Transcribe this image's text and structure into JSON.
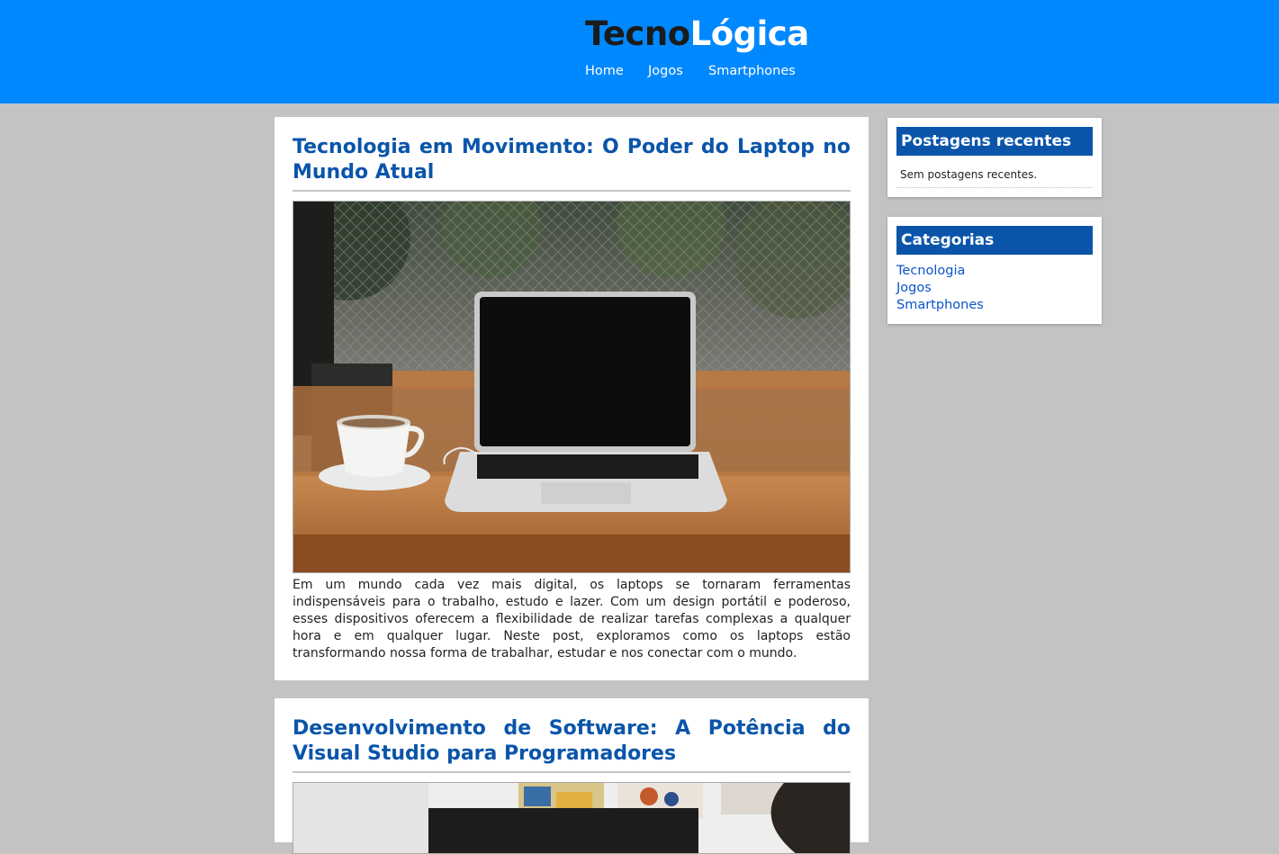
{
  "site": {
    "logo_part1": "Tecno",
    "logo_part2": "Lógica",
    "nav": [
      "Home",
      "Jogos",
      "Smartphones"
    ]
  },
  "posts": [
    {
      "title": "Tecnologia em Movimento: O Poder do Laptop no Mundo Atual",
      "image_icon": "laptop-photo-icon",
      "excerpt": "Em um mundo cada vez mais digital, os laptops se tornaram ferramentas indispensáveis para o trabalho, estudo e lazer. Com um design portátil e poderoso, esses dispositivos oferecem a flexibilidade de realizar tarefas complexas a qualquer hora e em qualquer lugar. Neste post, exploramos como os laptops estão transformando nossa forma de trabalhar, estudar e nos conectar com o mundo."
    },
    {
      "title": "Desenvolvimento de Software: A Potência do Visual Studio para Programadores",
      "image_icon": "desk-photo-icon"
    }
  ],
  "sidebar": {
    "recent": {
      "title": "Postagens recentes",
      "empty_text": "Sem postagens recentes."
    },
    "categories": {
      "title": "Categorias",
      "items": [
        "Tecnologia",
        "Jogos",
        "Smartphones"
      ]
    }
  },
  "colors": {
    "header_bg": "#0088ff",
    "accent": "#0a55aa",
    "page_bg": "#c3c3c3"
  }
}
